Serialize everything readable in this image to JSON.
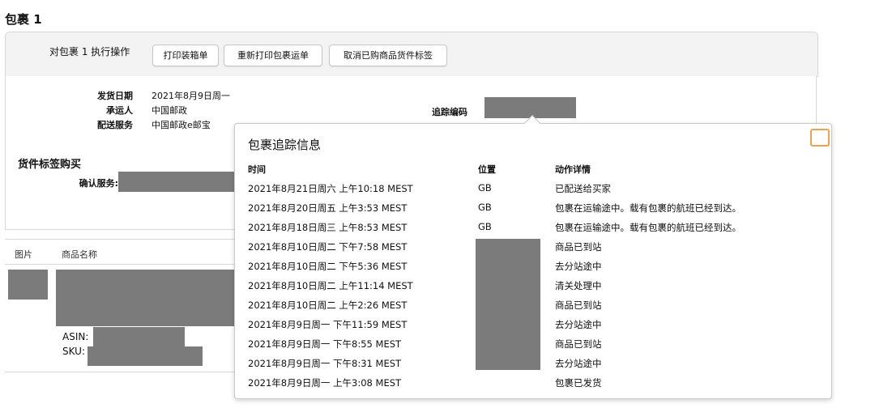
{
  "page": {
    "title": "包裹 1"
  },
  "actions": {
    "label": "对包裹 1 执行操作",
    "buttons": [
      "打印装箱单",
      "重新打印包裹运单",
      "取消已购商品货件标签"
    ]
  },
  "shipment": {
    "ship_date_label": "发货日期",
    "ship_date": "2021年8月9日周一",
    "carrier_label": "承运人",
    "carrier": "中国邮政",
    "service_label": "配送服务",
    "service": "中国邮政e邮宝",
    "tracking_label": "追踪编码"
  },
  "label_purchase": {
    "title": "货件标签购买",
    "confirm_label": "确认服务:"
  },
  "table": {
    "col_image": "图片",
    "col_name": "商品名称",
    "asin_label": "ASIN:",
    "sku_label": "SKU:"
  },
  "tracking": {
    "title": "包裹追踪信息",
    "col_time": "时间",
    "col_location": "位置",
    "col_detail": "动作详情",
    "rows": [
      {
        "time": "2021年8月21日周六 上午10:18 MEST",
        "location": "GB",
        "detail": "已配送给买家"
      },
      {
        "time": "2021年8月20日周五 上午3:53 MEST",
        "location": "GB",
        "detail": "包裹在运输途中。载有包裹的航班已经到达。"
      },
      {
        "time": "2021年8月18日周三 上午8:53 MEST",
        "location": "GB",
        "detail": "包裹在运输途中。载有包裹的航班已经到达。"
      },
      {
        "time": "2021年8月10日周二 下午7:58 MEST",
        "location": "",
        "detail": "商品已到站"
      },
      {
        "time": "2021年8月10日周二 下午5:36 MEST",
        "location": "",
        "detail": "去分站途中"
      },
      {
        "time": "2021年8月10日周二 上午11:14 MEST",
        "location": "",
        "detail": "清关处理中"
      },
      {
        "time": "2021年8月10日周二 上午2:26 MEST",
        "location": "",
        "detail": "商品已到站"
      },
      {
        "time": "2021年8月9日周一 下午11:59 MEST",
        "location": "",
        "detail": "去分站途中"
      },
      {
        "time": "2021年8月9日周一 下午8:55 MEST",
        "location": "",
        "detail": "商品已到站"
      },
      {
        "time": "2021年8月9日周一 下午8:31 MEST",
        "location": "",
        "detail": "去分站途中"
      },
      {
        "time": "2021年8月9日周一 上午3:08 MEST",
        "location": "",
        "detail": "包裹已发货"
      }
    ]
  }
}
